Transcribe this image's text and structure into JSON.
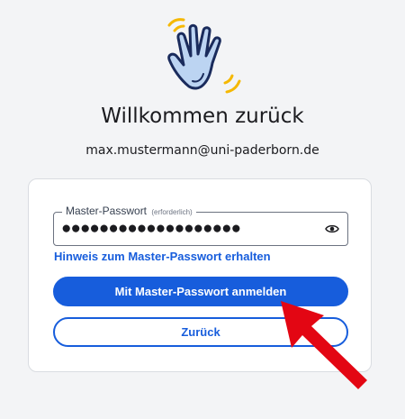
{
  "header": {
    "icon": "waving-hand-icon",
    "title": "Willkommen zurück",
    "email": "max.mustermann@uni-paderborn.de"
  },
  "form": {
    "password_label": "Master-Passwort",
    "password_required": "(erforderlich)",
    "password_value": "●●●●●●●●●●●●●●●●●●●",
    "toggle_icon": "eye-icon",
    "hint_link": "Hinweis zum Master-Passwort erhalten",
    "login_button": "Mit Master-Passwort anmelden",
    "back_button": "Zurück"
  },
  "annotation": {
    "arrow_color": "#e30613"
  },
  "colors": {
    "accent": "#175ddc",
    "background": "#f3f4f6"
  }
}
